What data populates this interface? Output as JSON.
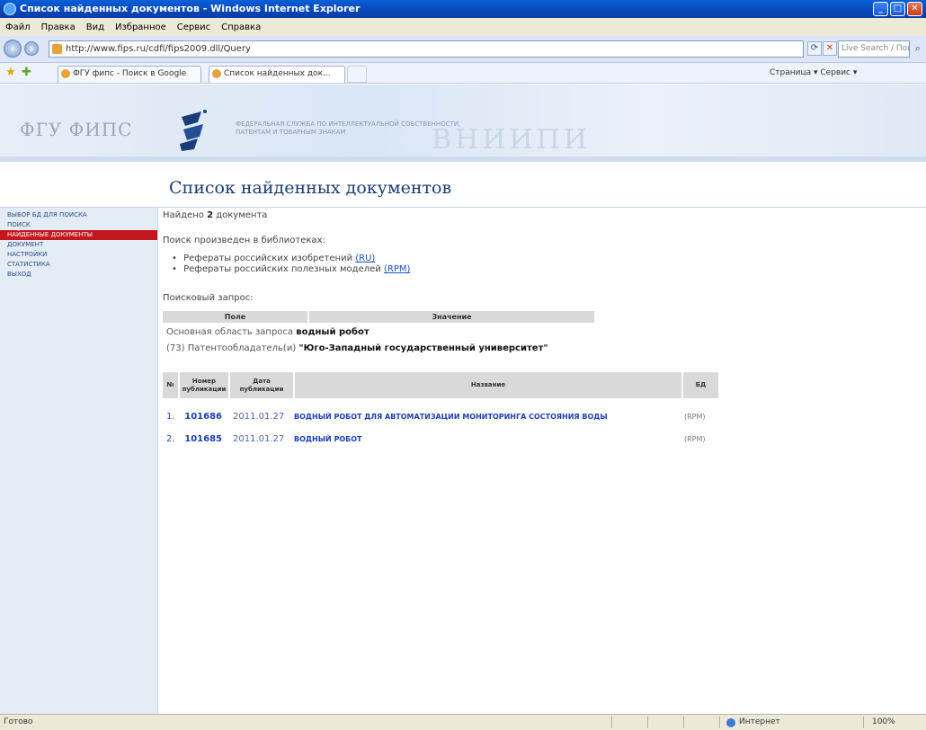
{
  "window": {
    "title": "Список найденных документов - Windows Internet Explorer"
  },
  "menu": [
    "Файл",
    "Правка",
    "Вид",
    "Избранное",
    "Сервис",
    "Справка"
  ],
  "address": {
    "url": "http://www.fips.ru/cdfi/fips2009.dll/Query",
    "search_placeholder": "Live Search / Поиск в Интернете"
  },
  "tabs": {
    "first": "ФГУ фипс - Поиск в Google",
    "second": "Список найденных док...",
    "commands": "Страница ▾  Сервис ▾"
  },
  "header": {
    "logo": "ФГУ ФИПС",
    "caption_line1": "Федеральная служба по интеллектуальной собственности,",
    "caption_line2": "патентам и товарным знакам",
    "watermark": "ВНИИПИ"
  },
  "page": {
    "title": "Список найденных документов"
  },
  "sidebar": {
    "items": [
      {
        "label": "выбор БД для поиска",
        "active": false
      },
      {
        "label": "поиск",
        "active": false
      },
      {
        "label": "найденные документы",
        "active": true
      },
      {
        "label": "документ",
        "active": false
      },
      {
        "label": "настройки",
        "active": false
      },
      {
        "label": "статистика",
        "active": false
      },
      {
        "label": "выход",
        "active": false
      }
    ]
  },
  "results": {
    "found_prefix": "Найдено",
    "found_count": "2",
    "found_suffix": "документа",
    "libraries_label": "Поиск произведен в библиотеках:",
    "libraries": [
      {
        "text": "Рефераты российских изобретений",
        "code": "(RU)"
      },
      {
        "text": "Рефераты российских полезных моделей",
        "code": "(RPM)"
      }
    ],
    "query_label": "Поисковый запрос:",
    "query_headers": {
      "field": "Поле",
      "value": "Значение"
    },
    "query_lines": [
      {
        "label": "Основная область запроса",
        "value": "водный робот"
      },
      {
        "label": "(73) Патентообладатель(и)",
        "value": "\"Юго-Западный государственный университет\""
      }
    ],
    "table_headers": {
      "no": "№",
      "pub_number": "Номер публикации",
      "pub_date": "Дата публикации",
      "title": "Название",
      "db": "БД"
    },
    "rows": [
      {
        "no": "1.",
        "pub_number": "101686",
        "pub_date": "2011.01.27",
        "title": "Водный робот для автоматизации мониторинга состояния воды",
        "db": "(RPM)"
      },
      {
        "no": "2.",
        "pub_number": "101685",
        "pub_date": "2011.01.27",
        "title": "Водный робот",
        "db": "(RPM)"
      }
    ]
  },
  "status": {
    "left": "Готово",
    "zone": "Интернет",
    "zoom": "100%"
  },
  "colors": {
    "sidebar_active": "#c3171d",
    "link": "#1d3fb0",
    "title": "#1d3b73"
  }
}
